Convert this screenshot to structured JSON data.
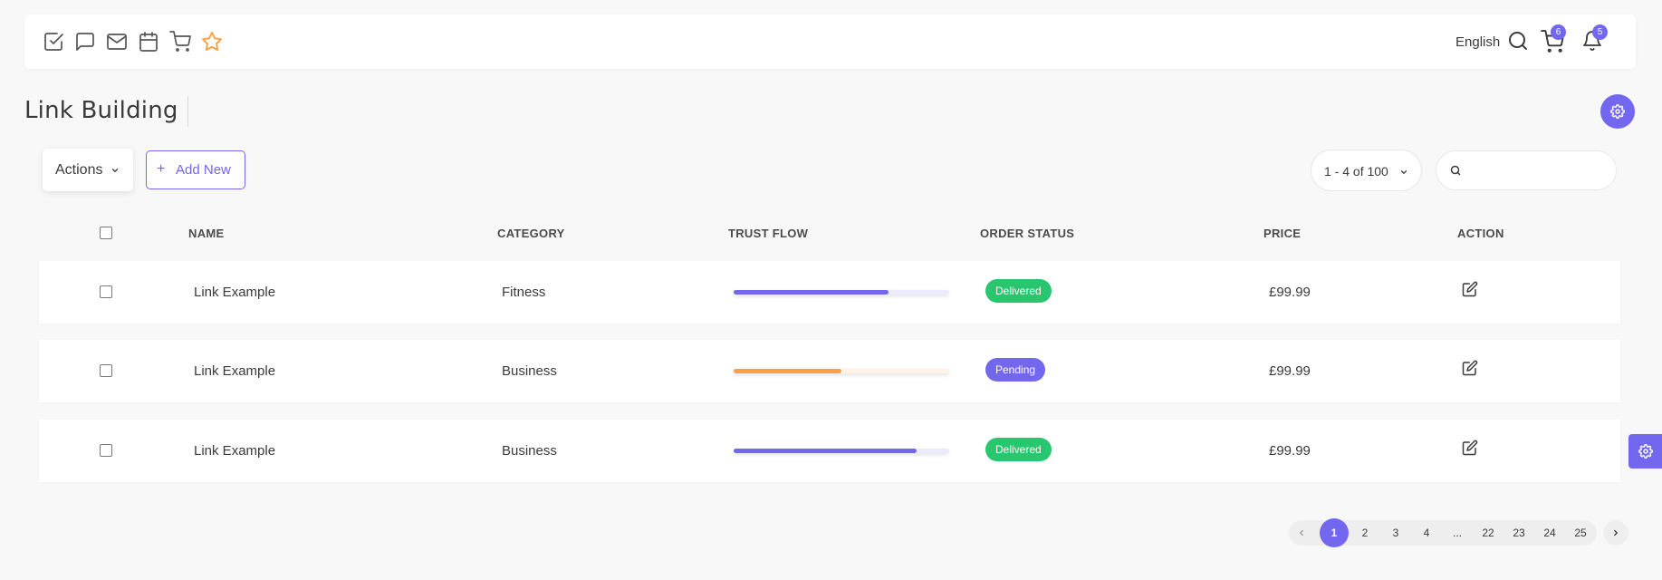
{
  "header": {
    "language": "English",
    "cart_badge": "6",
    "notifications_badge": "5",
    "quick_icons": [
      "checkbox-icon",
      "chat-icon",
      "mail-icon",
      "calendar-icon",
      "cart-icon",
      "star-icon"
    ]
  },
  "page": {
    "title": "Link Building"
  },
  "toolbar": {
    "actions_label": "Actions",
    "add_new_label": "Add New",
    "range_label": "1 - 4 of 100",
    "search_placeholder": ""
  },
  "table": {
    "columns": [
      "NAME",
      "CATEGORY",
      "TRUST FLOW",
      "ORDER STATUS",
      "PRICE",
      "ACTION"
    ],
    "rows": [
      {
        "name": "Link Example",
        "category": "Fitness",
        "trust_flow": 0.72,
        "trust_color": "#7367f0",
        "status": "Delivered",
        "status_color": "#28c76f",
        "price": "£99.99"
      },
      {
        "name": "Link Example",
        "category": "Business",
        "trust_flow": 0.5,
        "trust_color": "#ff9f43",
        "status": "Pending",
        "status_color": "#7367f0",
        "price": "£99.99"
      },
      {
        "name": "Link Example",
        "category": "Business",
        "trust_flow": 0.85,
        "trust_color": "#7367f0",
        "status": "Delivered",
        "status_color": "#28c76f",
        "price": "£99.99"
      }
    ]
  },
  "pagination": {
    "pages": [
      "1",
      "2",
      "3",
      "4",
      "...",
      "22",
      "23",
      "24",
      "25"
    ],
    "active": "1"
  },
  "colors": {
    "primary": "#7367f0",
    "success": "#28c76f",
    "warning": "#ff9f43"
  }
}
